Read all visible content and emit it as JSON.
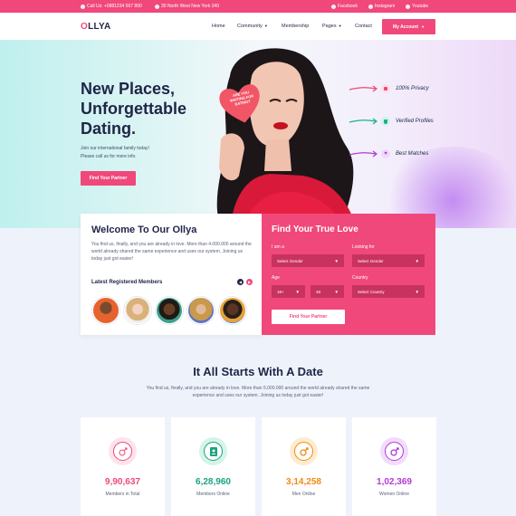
{
  "topbar": {
    "phone": "Call Us: +0881234 567 890",
    "address": "30 North West New York 240",
    "facebook": "Facebook",
    "instagram": "Instagram",
    "youtube": "Youtube"
  },
  "nav": {
    "logo_accent": "O",
    "logo_rest": "LLYA",
    "home": "Home",
    "community": "Community",
    "membership": "Membership",
    "pages": "Pages",
    "contact": "Contact",
    "account": "My Account"
  },
  "hero": {
    "title_line1": "New Places,",
    "title_line2": "Unforgettable",
    "title_line3": "Dating.",
    "sub_line1": "Join our international family today!",
    "sub_line2": "Please call us for more info.",
    "button": "Find Your Partner",
    "heart_text_1": "ARE YOU",
    "heart_text_2": "WAITING FOR",
    "heart_text_3": "DATING?",
    "features": [
      "100% Privacy",
      "Verified Profiles",
      "Best Matches"
    ]
  },
  "welcome": {
    "title": "Welcome To Our Ollya",
    "text": "You find us, finally, and you are already in love. More than 4.000.000 around the world already shared the same experience and uses our system. Joining us today just got easier!",
    "latest": "Latest Registered Members"
  },
  "find": {
    "title": "Find Your True Love",
    "iam_label": "I am a",
    "iam_value": "Select Gender",
    "looking_label": "Looking for",
    "looking_value": "Select Gender",
    "age_label": "Age",
    "age_from": "18+",
    "age_to": "48",
    "country_label": "Country",
    "country_value": "Select Country",
    "button": "Find Your Partner"
  },
  "section": {
    "title": "It All Starts With A Date",
    "sub": "You find us, finally, and you are already in love. More than 5.000.000 around the world already shared the same experience and uses our system. Joining us today just got easier!"
  },
  "stats": [
    {
      "number": "9,90,637",
      "caption": "Members in Total",
      "color": "#f0487a"
    },
    {
      "number": "6,28,960",
      "caption": "Members Online",
      "color": "#19a37f"
    },
    {
      "number": "3,14,258",
      "caption": "Men Online",
      "color": "#f08a12"
    },
    {
      "number": "1,02,369",
      "caption": "Women Online",
      "color": "#b13ad8"
    }
  ],
  "colors": {
    "accent": "#f0487a",
    "navy": "#1f2547"
  }
}
